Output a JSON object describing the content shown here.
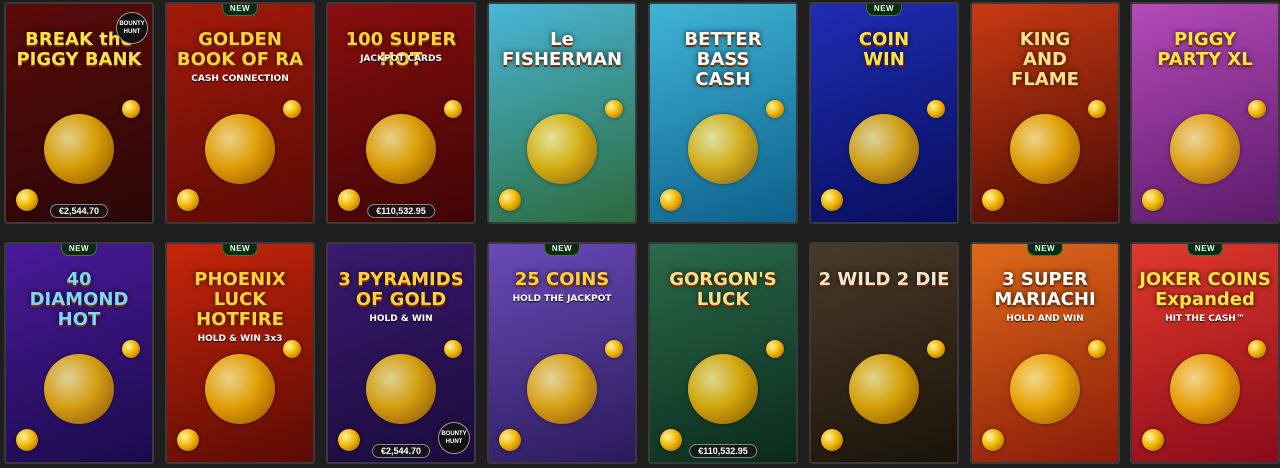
{
  "badge_new_label": "NEW",
  "row1": [
    {
      "title": "BREAK the\nPIGGY BANK",
      "sub": "",
      "new": false,
      "jackpot": "€2,544.70",
      "bounty": "BOUNTY HUNT",
      "bounty_pos": "top",
      "bg": [
        "#5a0b0b",
        "#2a0606"
      ],
      "title_color": "#ffe24a"
    },
    {
      "title": "GOLDEN\nBOOK OF RA",
      "sub": "CASH CONNECTION",
      "new": true,
      "jackpot": "",
      "bounty": "",
      "bounty_pos": "",
      "bg": [
        "#a31a0a",
        "#5a0a04"
      ],
      "title_color": "#ffd13a"
    },
    {
      "title": "100 SUPER HOT",
      "sub": "JACKPOT CARDS",
      "new": false,
      "jackpot": "€110,532.95",
      "bounty": "",
      "bounty_pos": "",
      "bg": [
        "#8a0e0e",
        "#3e0404"
      ],
      "title_color": "#ffd13a"
    },
    {
      "title": "Le\nFISHERMAN",
      "sub": "",
      "new": false,
      "jackpot": "",
      "bounty": "",
      "bounty_pos": "",
      "bg": [
        "#49b7d8",
        "#2b6a3a"
      ],
      "title_color": "#ffffff"
    },
    {
      "title": "BETTER\nBASS\nCASH",
      "sub": "",
      "new": false,
      "jackpot": "",
      "bounty": "",
      "bounty_pos": "",
      "bg": [
        "#3fb5d6",
        "#0d5f8a"
      ],
      "title_color": "#ffffff"
    },
    {
      "title": "COIN\nWIN",
      "sub": "",
      "new": true,
      "jackpot": "",
      "bounty": "",
      "bounty_pos": "",
      "bg": [
        "#1f2cb5",
        "#070e5a"
      ],
      "title_color": "#ffe24a"
    },
    {
      "title": "KING\nAND\nFLAME",
      "sub": "",
      "new": false,
      "jackpot": "",
      "bounty": "",
      "bounty_pos": "",
      "bg": [
        "#c83a12",
        "#4a0a04"
      ],
      "title_color": "#ffe08a"
    },
    {
      "title": "PIGGY\nPARTY XL",
      "sub": "",
      "new": false,
      "jackpot": "",
      "bounty": "",
      "bounty_pos": "",
      "bg": [
        "#b54ab8",
        "#5a1a6a"
      ],
      "title_color": "#ffe24a"
    }
  ],
  "row2": [
    {
      "title": "40\nDIAMOND\nHOT",
      "sub": "",
      "new": true,
      "jackpot": "",
      "bounty": "",
      "bounty_pos": "",
      "bg": [
        "#4a1a9a",
        "#1a0a4a"
      ],
      "title_color": "#7ad9ff"
    },
    {
      "title": "PHOENIX\nLUCK\nHOTFIRE",
      "sub": "HOLD & WIN 3x3",
      "new": true,
      "jackpot": "",
      "bounty": "",
      "bounty_pos": "",
      "bg": [
        "#c8250a",
        "#5a0a04"
      ],
      "title_color": "#ffd13a"
    },
    {
      "title": "3 PYRAMIDS\nOF GOLD",
      "sub": "HOLD & WIN",
      "new": false,
      "jackpot": "€2,544.70",
      "bounty": "BOUNTY HUNT",
      "bounty_pos": "bottom",
      "bg": [
        "#3a1a70",
        "#1a0a3a"
      ],
      "title_color": "#ffd13a"
    },
    {
      "title": "25 COINS",
      "sub": "HOLD THE JACKPOT",
      "new": true,
      "jackpot": "",
      "bounty": "",
      "bounty_pos": "",
      "bg": [
        "#6a4ab8",
        "#2a1a5a"
      ],
      "title_color": "#ffd13a"
    },
    {
      "title": "GORGON'S\nLUCK",
      "sub": "",
      "new": false,
      "jackpot": "€110,532.95",
      "bounty": "",
      "bounty_pos": "",
      "bg": [
        "#2a6a4a",
        "#0a2a1a"
      ],
      "title_color": "#ffe08a"
    },
    {
      "title": "2 WILD 2 DIE",
      "sub": "",
      "new": false,
      "jackpot": "",
      "bounty": "",
      "bounty_pos": "",
      "bg": [
        "#4a3a2a",
        "#1a1208"
      ],
      "title_color": "#f0e6d0"
    },
    {
      "title": "3 SUPER\nMARIACHI",
      "sub": "HOLD AND WIN",
      "new": true,
      "jackpot": "",
      "bounty": "",
      "bounty_pos": "",
      "bg": [
        "#e06a1a",
        "#8a1a08"
      ],
      "title_color": "#ffffff"
    },
    {
      "title": "JOKER COINS\nExpanded",
      "sub": "HIT THE CASH™",
      "new": true,
      "jackpot": "",
      "bounty": "",
      "bounty_pos": "",
      "bg": [
        "#e03a2a",
        "#8a0a1a"
      ],
      "title_color": "#ffe24a"
    }
  ]
}
